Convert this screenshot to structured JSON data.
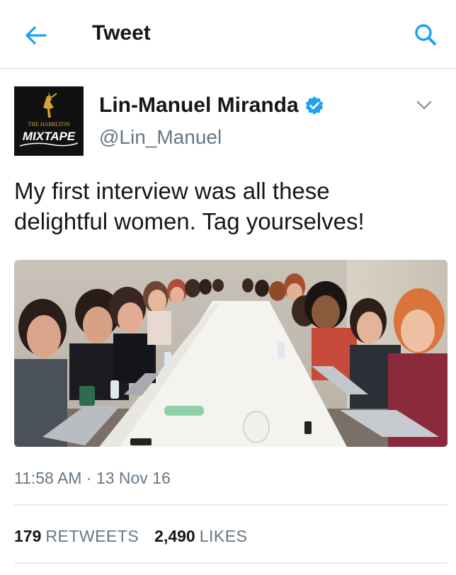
{
  "header": {
    "title": "Tweet",
    "back_icon": "arrow-left-icon",
    "search_icon": "search-icon",
    "accent_color": "#1da1f2"
  },
  "tweet": {
    "author": {
      "display_name": "Lin-Manuel Miranda",
      "handle": "@Lin_Manuel",
      "verified": true,
      "avatar_text": {
        "top": "THE HAMILTON",
        "bottom": "MIXTAPE"
      }
    },
    "text_lines": [
      "My first interview was all these",
      "delightful women. Tag yourselves!"
    ],
    "timestamp": "11:58 AM · 13 Nov 16",
    "stats": {
      "retweets_count": "179",
      "retweets_label": "RETWEETS",
      "likes_count": "2,490",
      "likes_label": "LIKES"
    }
  },
  "colors": {
    "text_primary": "#14171a",
    "text_secondary": "#657786",
    "divider": "#e6ecf0",
    "verified_badge": "#1da1f2"
  }
}
